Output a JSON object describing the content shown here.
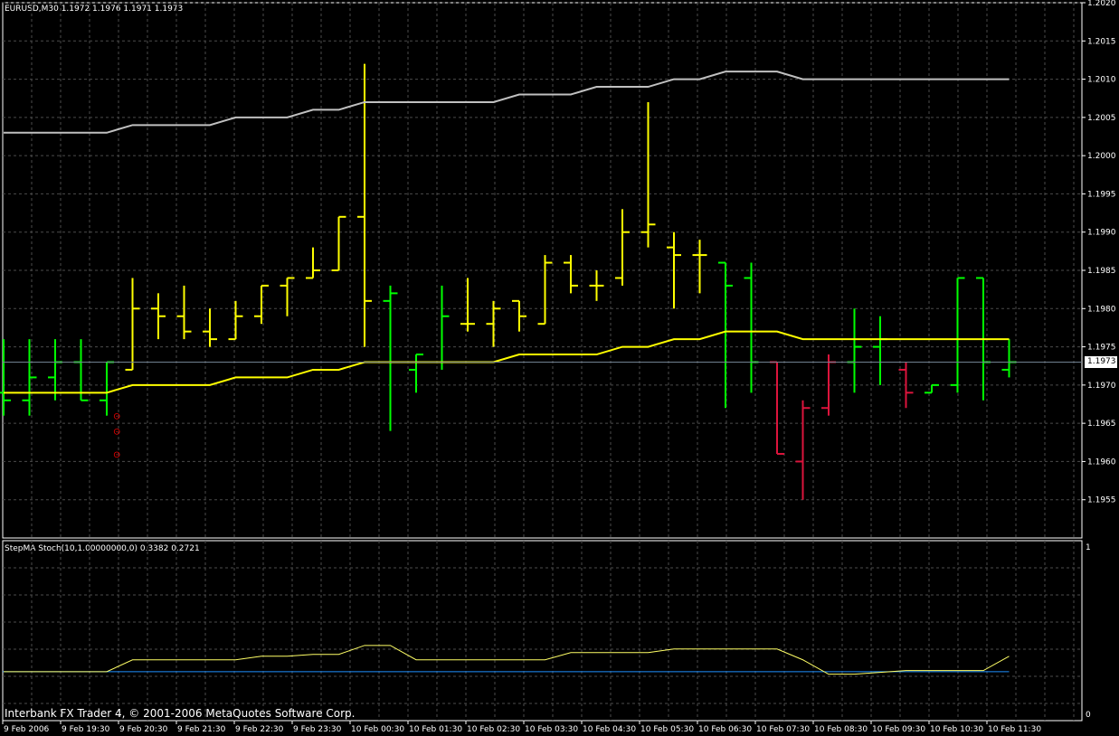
{
  "window": {
    "symbol_header": "EURUSD,M30  1.1972 1.1976 1.1971 1.1973",
    "indicator_header": "StepMA Stoch(10,1.00000000,0) 0.3382 0.2721",
    "copyright": "Interbank FX Trader 4, © 2001-2006 MetaQuotes Software Corp.",
    "current_price_label": "1.1973"
  },
  "colors": {
    "background": "#000000",
    "grid": "#4b4b4b",
    "bull_bar": "#00ff00",
    "bear_bar": "#ffff00",
    "down_bar": "#dc143c",
    "ma_fast": "#ffff00",
    "ma_slow": "#c0c0c0",
    "indicator_line": "#ffff66",
    "indicator_base": "#1e90ff",
    "marker": "#ff0000"
  },
  "chart_data": {
    "type": "ohlc",
    "price_axis": {
      "min": 1.195,
      "max": 1.202,
      "ticks": [
        "1.2020",
        "1.2015",
        "1.2010",
        "1.2005",
        "1.2000",
        "1.1995",
        "1.1990",
        "1.1985",
        "1.1980",
        "1.1975",
        "1.1970",
        "1.1965",
        "1.1960",
        "1.1955"
      ]
    },
    "time_labels": [
      "9 Feb 2006",
      "9 Feb 19:30",
      "9 Feb 20:30",
      "9 Feb 21:30",
      "9 Feb 22:30",
      "9 Feb 23:30",
      "10 Feb 00:30",
      "10 Feb 01:30",
      "10 Feb 02:30",
      "10 Feb 03:30",
      "10 Feb 04:30",
      "10 Feb 05:30",
      "10 Feb 06:30",
      "10 Feb 07:30",
      "10 Feb 08:30",
      "10 Feb 09:30",
      "10 Feb 10:30",
      "10 Feb 11:30"
    ],
    "bars": [
      {
        "o": 1.1969,
        "h": 1.1976,
        "l": 1.1966,
        "c": 1.1968,
        "color": "bull"
      },
      {
        "o": 1.1968,
        "h": 1.1976,
        "l": 1.1966,
        "c": 1.1971,
        "color": "bull"
      },
      {
        "o": 1.1971,
        "h": 1.1976,
        "l": 1.1968,
        "c": 1.1973,
        "color": "bull"
      },
      {
        "o": 1.1973,
        "h": 1.1976,
        "l": 1.1968,
        "c": 1.1968,
        "color": "bull"
      },
      {
        "o": 1.1968,
        "h": 1.1973,
        "l": 1.1966,
        "c": 1.1973,
        "color": "bull"
      },
      {
        "o": 1.1972,
        "h": 1.1984,
        "l": 1.1972,
        "c": 1.198,
        "color": "bear"
      },
      {
        "o": 1.198,
        "h": 1.1982,
        "l": 1.1976,
        "c": 1.1979,
        "color": "bear"
      },
      {
        "o": 1.1979,
        "h": 1.1983,
        "l": 1.1976,
        "c": 1.1977,
        "color": "bear"
      },
      {
        "o": 1.1977,
        "h": 1.198,
        "l": 1.1975,
        "c": 1.1976,
        "color": "bear"
      },
      {
        "o": 1.1976,
        "h": 1.1981,
        "l": 1.1976,
        "c": 1.1979,
        "color": "bear"
      },
      {
        "o": 1.1979,
        "h": 1.1983,
        "l": 1.1978,
        "c": 1.1983,
        "color": "bear"
      },
      {
        "o": 1.1983,
        "h": 1.1984,
        "l": 1.1979,
        "c": 1.1984,
        "color": "bear"
      },
      {
        "o": 1.1984,
        "h": 1.1988,
        "l": 1.1984,
        "c": 1.1985,
        "color": "bear"
      },
      {
        "o": 1.1985,
        "h": 1.1992,
        "l": 1.1986,
        "c": 1.1992,
        "color": "bear"
      },
      {
        "o": 1.1992,
        "h": 1.2012,
        "l": 1.1975,
        "c": 1.1981,
        "color": "bear"
      },
      {
        "o": 1.1981,
        "h": 1.1983,
        "l": 1.1964,
        "c": 1.1982,
        "color": "bull"
      },
      {
        "o": 1.1972,
        "h": 1.1974,
        "l": 1.1969,
        "c": 1.1974,
        "color": "bull"
      },
      {
        "o": 1.1973,
        "h": 1.1983,
        "l": 1.1972,
        "c": 1.1979,
        "color": "bull"
      },
      {
        "o": 1.1978,
        "h": 1.1984,
        "l": 1.1977,
        "c": 1.1978,
        "color": "bear"
      },
      {
        "o": 1.1978,
        "h": 1.1981,
        "l": 1.1975,
        "c": 1.198,
        "color": "bear"
      },
      {
        "o": 1.1981,
        "h": 1.1981,
        "l": 1.1977,
        "c": 1.1979,
        "color": "bear"
      },
      {
        "o": 1.1978,
        "h": 1.1987,
        "l": 1.1978,
        "c": 1.1986,
        "color": "bear"
      },
      {
        "o": 1.1986,
        "h": 1.1987,
        "l": 1.1982,
        "c": 1.1983,
        "color": "bear"
      },
      {
        "o": 1.1983,
        "h": 1.1985,
        "l": 1.1981,
        "c": 1.1983,
        "color": "bear"
      },
      {
        "o": 1.1984,
        "h": 1.1993,
        "l": 1.1983,
        "c": 1.199,
        "color": "bear"
      },
      {
        "o": 1.199,
        "h": 1.2007,
        "l": 1.1988,
        "c": 1.1991,
        "color": "bear"
      },
      {
        "o": 1.1988,
        "h": 1.199,
        "l": 1.198,
        "c": 1.1987,
        "color": "bear"
      },
      {
        "o": 1.1987,
        "h": 1.1989,
        "l": 1.1982,
        "c": 1.1987,
        "color": "bear"
      },
      {
        "o": 1.1986,
        "h": 1.1986,
        "l": 1.1967,
        "c": 1.1983,
        "color": "bull"
      },
      {
        "o": 1.1984,
        "h": 1.1986,
        "l": 1.1969,
        "c": 1.1973,
        "color": "bull"
      },
      {
        "o": 1.1973,
        "h": 1.1973,
        "l": 1.1961,
        "c": 1.1961,
        "color": "down"
      },
      {
        "o": 1.196,
        "h": 1.1968,
        "l": 1.1955,
        "c": 1.1967,
        "color": "down"
      },
      {
        "o": 1.1967,
        "h": 1.1974,
        "l": 1.1966,
        "c": 1.1973,
        "color": "down"
      },
      {
        "o": 1.1973,
        "h": 1.198,
        "l": 1.1969,
        "c": 1.1975,
        "color": "bull"
      },
      {
        "o": 1.1975,
        "h": 1.1979,
        "l": 1.197,
        "c": 1.1976,
        "color": "bull"
      },
      {
        "o": 1.1972,
        "h": 1.1973,
        "l": 1.1967,
        "c": 1.1969,
        "color": "down"
      },
      {
        "o": 1.1969,
        "h": 1.197,
        "l": 1.197,
        "c": 1.197,
        "color": "bull"
      },
      {
        "o": 1.197,
        "h": 1.1984,
        "l": 1.1969,
        "c": 1.1984,
        "color": "bull"
      },
      {
        "o": 1.1984,
        "h": 1.1983,
        "l": 1.1968,
        "c": 1.1973,
        "color": "bull"
      },
      {
        "o": 1.1972,
        "h": 1.1976,
        "l": 1.1971,
        "c": 1.1973,
        "color": "bull"
      }
    ],
    "ma_fast": [
      1.1969,
      1.1969,
      1.1969,
      1.1969,
      1.1969,
      1.197,
      1.197,
      1.197,
      1.197,
      1.1971,
      1.1971,
      1.1971,
      1.1972,
      1.1972,
      1.1973,
      1.1973,
      1.1973,
      1.1973,
      1.1973,
      1.1973,
      1.1974,
      1.1974,
      1.1974,
      1.1974,
      1.1975,
      1.1975,
      1.1976,
      1.1976,
      1.1977,
      1.1977,
      1.1977,
      1.1976,
      1.1976,
      1.1976,
      1.1976,
      1.1976,
      1.1976,
      1.1976,
      1.1976,
      1.1976
    ],
    "ma_slow": [
      1.2003,
      1.2003,
      1.2003,
      1.2003,
      1.2003,
      1.2004,
      1.2004,
      1.2004,
      1.2004,
      1.2005,
      1.2005,
      1.2005,
      1.2006,
      1.2006,
      1.2007,
      1.2007,
      1.2007,
      1.2007,
      1.2007,
      1.2007,
      1.2008,
      1.2008,
      1.2008,
      1.2009,
      1.2009,
      1.2009,
      1.201,
      1.201,
      1.2011,
      1.2011,
      1.2011,
      1.201,
      1.201,
      1.201,
      1.201,
      1.201,
      1.201,
      1.201,
      1.201,
      1.201
    ],
    "markers": [
      1.1966,
      1.1964,
      1.1961
    ],
    "indicator": {
      "axis_max": "1",
      "axis_min": "0",
      "values": [
        0.272,
        0.272,
        0.272,
        0.272,
        0.272,
        0.338,
        0.338,
        0.338,
        0.338,
        0.338,
        0.358,
        0.358,
        0.368,
        0.368,
        0.418,
        0.418,
        0.338,
        0.338,
        0.338,
        0.338,
        0.338,
        0.338,
        0.378,
        0.378,
        0.378,
        0.378,
        0.398,
        0.398,
        0.398,
        0.398,
        0.398,
        0.338,
        0.258,
        0.258,
        0.268,
        0.278,
        0.278,
        0.278,
        0.278,
        0.358
      ],
      "base": 0.272
    }
  }
}
